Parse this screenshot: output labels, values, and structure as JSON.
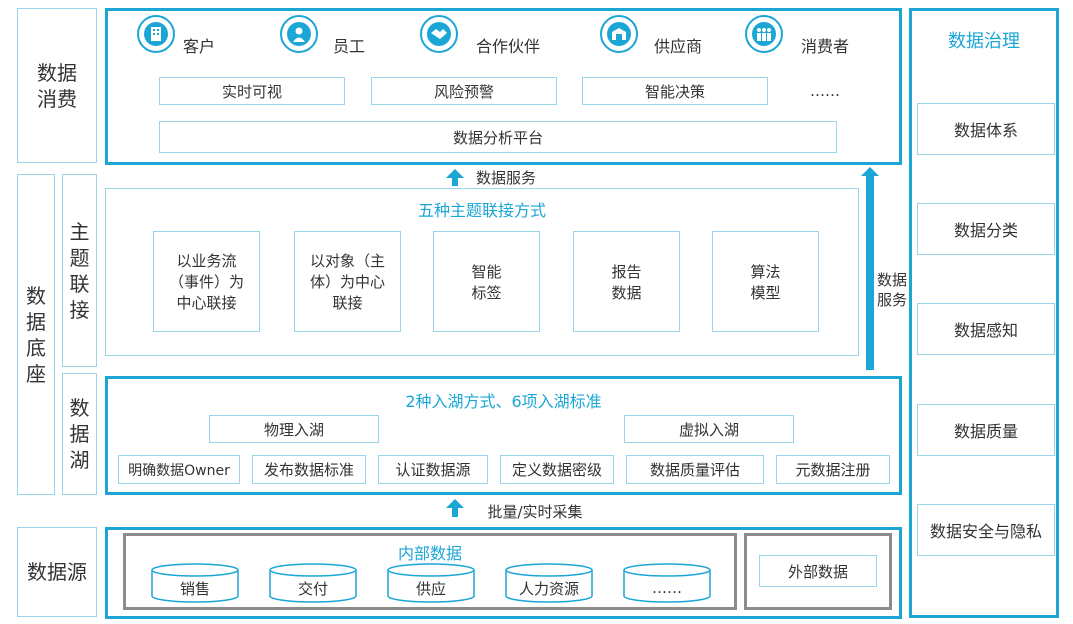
{
  "left_labels": {
    "consumption": "数据\n消费",
    "base": "数据\n底座",
    "theme_link": "主\n题\n联\n接",
    "lake": "数\n据\n湖",
    "source": "数据源"
  },
  "consumers": [
    {
      "label": "客户",
      "icon": "building-icon"
    },
    {
      "label": "员工",
      "icon": "person-icon"
    },
    {
      "label": "合作伙伴",
      "icon": "handshake-icon"
    },
    {
      "label": "供应商",
      "icon": "warehouse-icon"
    },
    {
      "label": "消费者",
      "icon": "people-group-icon"
    }
  ],
  "apps": [
    "实时可视",
    "风险预警",
    "智能决策",
    "……"
  ],
  "platform": "数据分析平台",
  "service_label": "数据服务",
  "service_side_label": "数据\n服务",
  "theme": {
    "title": "五种主题联接方式",
    "items": [
      "以业务流\n（事件）为\n中心联接",
      "以对象（主\n体）为中心\n联接",
      "智能\n标签",
      "报告\n数据",
      "算法\n模型"
    ]
  },
  "lake": {
    "title": "2种入湖方式、6项入湖标准",
    "modes": [
      "物理入湖",
      "虚拟入湖"
    ],
    "standards": [
      "明确数据Owner",
      "发布数据标准",
      "认证数据源",
      "定义数据密级",
      "数据质量评估",
      "元数据注册"
    ]
  },
  "collect_label": "批量/实时采集",
  "source": {
    "internal_title": "内部数据",
    "internal_items": [
      "销售",
      "交付",
      "供应",
      "人力资源",
      "……"
    ],
    "external": "外部数据"
  },
  "governance": {
    "title": "数据治理",
    "items": [
      "数据体系",
      "数据分类",
      "数据感知",
      "数据质量",
      "数据安全与隐私"
    ]
  }
}
